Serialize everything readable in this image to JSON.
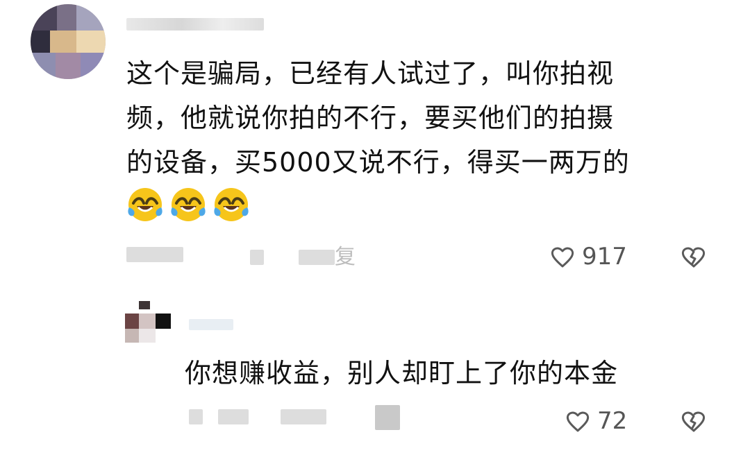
{
  "comments": [
    {
      "text": "这个是骗局，已经有人试过了，叫你拍视\n频，他就说你拍的不行，要买他们的拍摄\n的设备，买5000又说不行，得买一两万的",
      "emoji": "laughing-crying-face",
      "meta_reply_fragment": "复",
      "likes": "917"
    },
    {
      "text": "你想赚收益，别人却盯上了你的本金",
      "likes": "72"
    }
  ],
  "colors": {
    "text": "#111111",
    "muted": "#555555",
    "blur": "#dddddd"
  }
}
